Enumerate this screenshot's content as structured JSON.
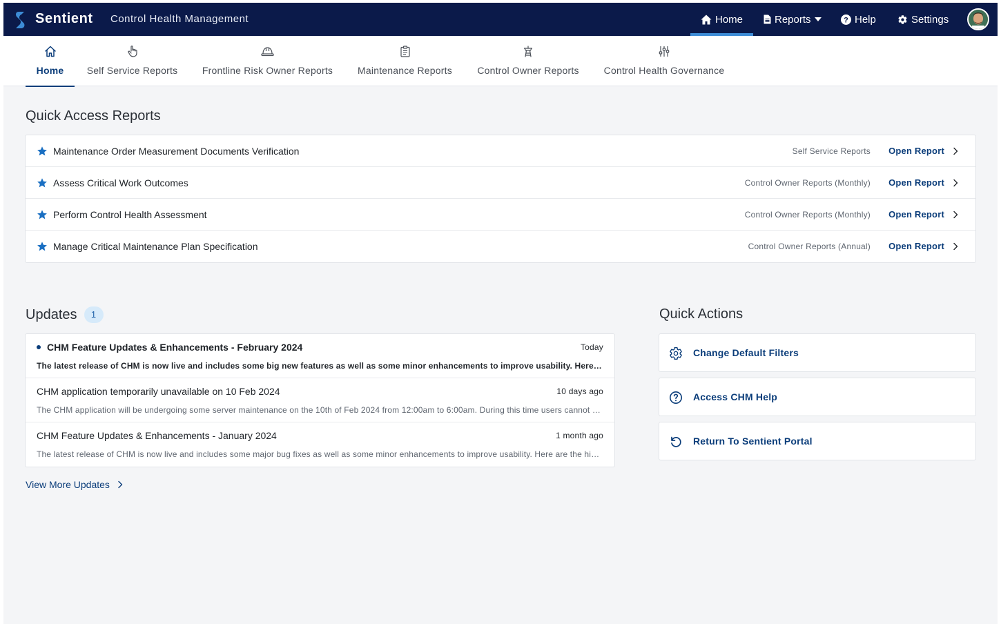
{
  "colors": {
    "topbar_bg": "#0b1a4a",
    "accent": "#0b3d7a",
    "star": "#1a6fc2",
    "badge_bg": "#d6eafa",
    "page_bg": "#f4f5f7"
  },
  "topbar": {
    "brand": "Sentient",
    "app_title": "Control Health Management",
    "nav": [
      {
        "label": "Home",
        "icon": "home-icon",
        "active": true
      },
      {
        "label": "Reports",
        "icon": "document-icon",
        "dropdown": true
      },
      {
        "label": "Help",
        "icon": "question-icon"
      },
      {
        "label": "Settings",
        "icon": "gear-icon"
      }
    ]
  },
  "subnav": {
    "tabs": [
      {
        "label": "Home",
        "icon": "home-icon",
        "active": true
      },
      {
        "label": "Self Service Reports",
        "icon": "pointer-hand-icon"
      },
      {
        "label": "Frontline Risk Owner Reports",
        "icon": "hard-hat-icon"
      },
      {
        "label": "Maintenance Reports",
        "icon": "clipboard-icon"
      },
      {
        "label": "Control Owner Reports",
        "icon": "tower-icon"
      },
      {
        "label": "Control Health Governance",
        "icon": "sliders-icon"
      }
    ]
  },
  "quick_access": {
    "title": "Quick Access Reports",
    "open_label": "Open Report",
    "items": [
      {
        "name": "Maintenance Order Measurement Documents Verification",
        "category": "Self Service Reports"
      },
      {
        "name": "Assess Critical Work Outcomes",
        "category": "Control Owner Reports (Monthly)"
      },
      {
        "name": "Perform Control Health Assessment",
        "category": "Control Owner Reports (Monthly)"
      },
      {
        "name": "Manage Critical Maintenance Plan Specification",
        "category": "Control Owner Reports (Annual)"
      }
    ]
  },
  "updates": {
    "title": "Updates",
    "count": "1",
    "items": [
      {
        "title": "CHM Feature Updates & Enhancements - February 2024",
        "time": "Today",
        "body": "The latest release of CHM is now live and includes some big new features as well as some minor enhancements to improve usability. Here are the highlights of this release.",
        "unread": true
      },
      {
        "title": "CHM application temporarily unavailable on 10 Feb 2024",
        "time": "10 days ago",
        "body": "The CHM application will be undergoing some server maintenance on the 10th of Feb 2024 from 12:00am to 6:00am. During this time users cannot access the application.",
        "unread": false
      },
      {
        "title": "CHM Feature Updates & Enhancements - January 2024",
        "time": "1 month ago",
        "body": "The latest release of CHM is now live and includes some major bug fixes as well as some minor enhancements to improve usability. Here are the highlights.",
        "unread": false
      }
    ],
    "view_more": "View More Updates"
  },
  "quick_actions": {
    "title": "Quick Actions",
    "items": [
      {
        "label": "Change Default Filters",
        "icon": "gear-icon"
      },
      {
        "label": "Access CHM Help",
        "icon": "question-circle-icon"
      },
      {
        "label": "Return To Sentient Portal",
        "icon": "return-arrow-icon"
      }
    ]
  }
}
